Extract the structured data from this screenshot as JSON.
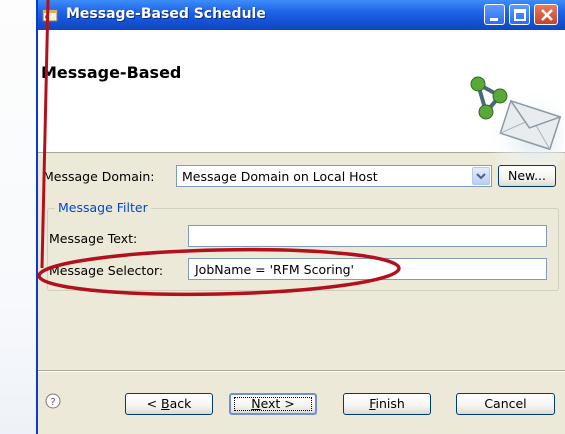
{
  "window": {
    "title": "Message-Based Schedule"
  },
  "header": {
    "page_title": "Message-Based"
  },
  "form": {
    "domain_label": "Message Domain:",
    "domain_value": "Message Domain on Local Host",
    "new_button": "New...",
    "filter_group_title": "Message Filter",
    "text_label": "Message Text:",
    "text_value": "",
    "selector_label": "Message Selector:",
    "selector_value": "JobName = 'RFM Scoring'"
  },
  "footer": {
    "back": {
      "pre": "< ",
      "mnemonic": "B",
      "post": "ack"
    },
    "next": {
      "pre": "",
      "mnemonic": "N",
      "post": "ext >"
    },
    "finish": {
      "pre": "",
      "mnemonic": "F",
      "post": "inish"
    },
    "cancel": "Cancel"
  },
  "colors": {
    "titlebar": "#1f63e6",
    "annotation": "#b3101e",
    "group_title": "#0046d5"
  },
  "icons": {
    "title": "app-window-icon",
    "banner": "network-envelope-icon",
    "help": "help-icon"
  }
}
